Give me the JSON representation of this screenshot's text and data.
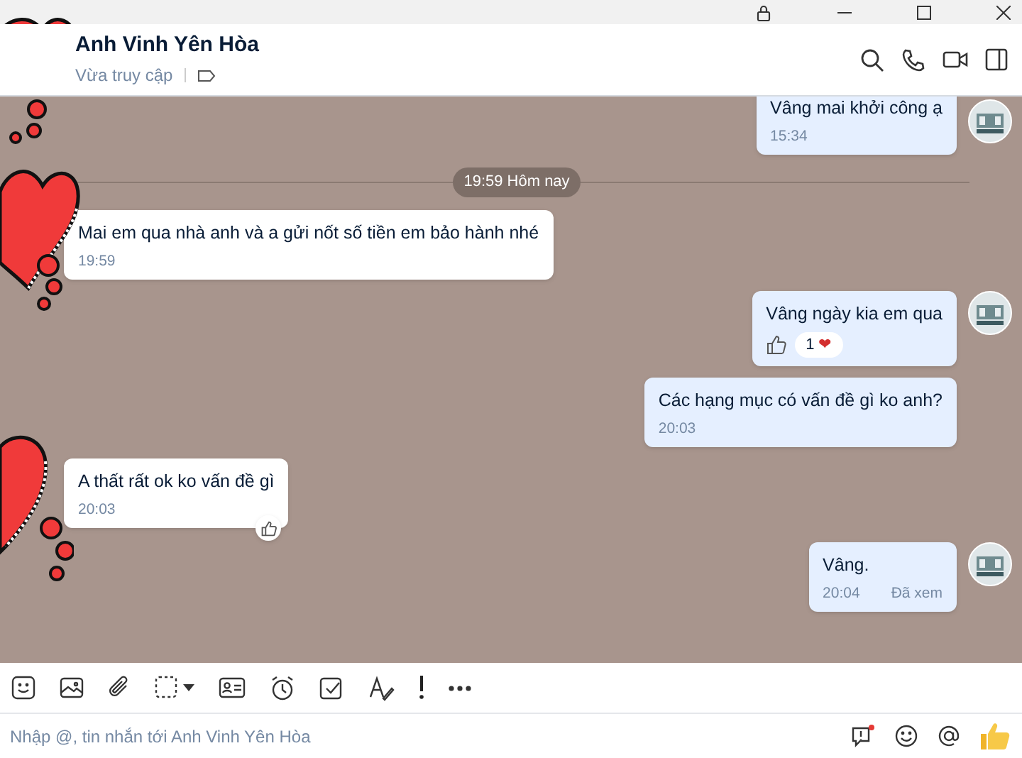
{
  "header": {
    "name": "Anh Vinh Yên Hòa",
    "status": "Vừa truy cập"
  },
  "messages": [
    {
      "kind": "out",
      "text": "Vâng mai khởi công ạ",
      "time": "15:34",
      "avatar": true
    },
    {
      "kind": "date",
      "text": "19:59 Hôm nay"
    },
    {
      "kind": "in",
      "text": "Mai em qua nhà anh và a gửi nốt số tiền em bảo hành nhé",
      "time": "19:59"
    },
    {
      "kind": "out",
      "text": "Vâng ngày kia em qua",
      "avatar": true,
      "reaction": {
        "count": "1",
        "emoji": "❤"
      }
    },
    {
      "kind": "out",
      "text": "Các hạng mục có vấn đề gì ko anh?",
      "time": "20:03",
      "avatar": false
    },
    {
      "kind": "in",
      "text": "A thất rất ok ko vấn đề gì",
      "time": "20:03",
      "like_button": true
    },
    {
      "kind": "out",
      "text": "Vâng.",
      "time": "20:04",
      "seen": "Đã xem",
      "avatar": true
    }
  ],
  "composer": {
    "placeholder": "Nhập @, tin nhắn tới Anh Vinh Yên Hòa"
  }
}
